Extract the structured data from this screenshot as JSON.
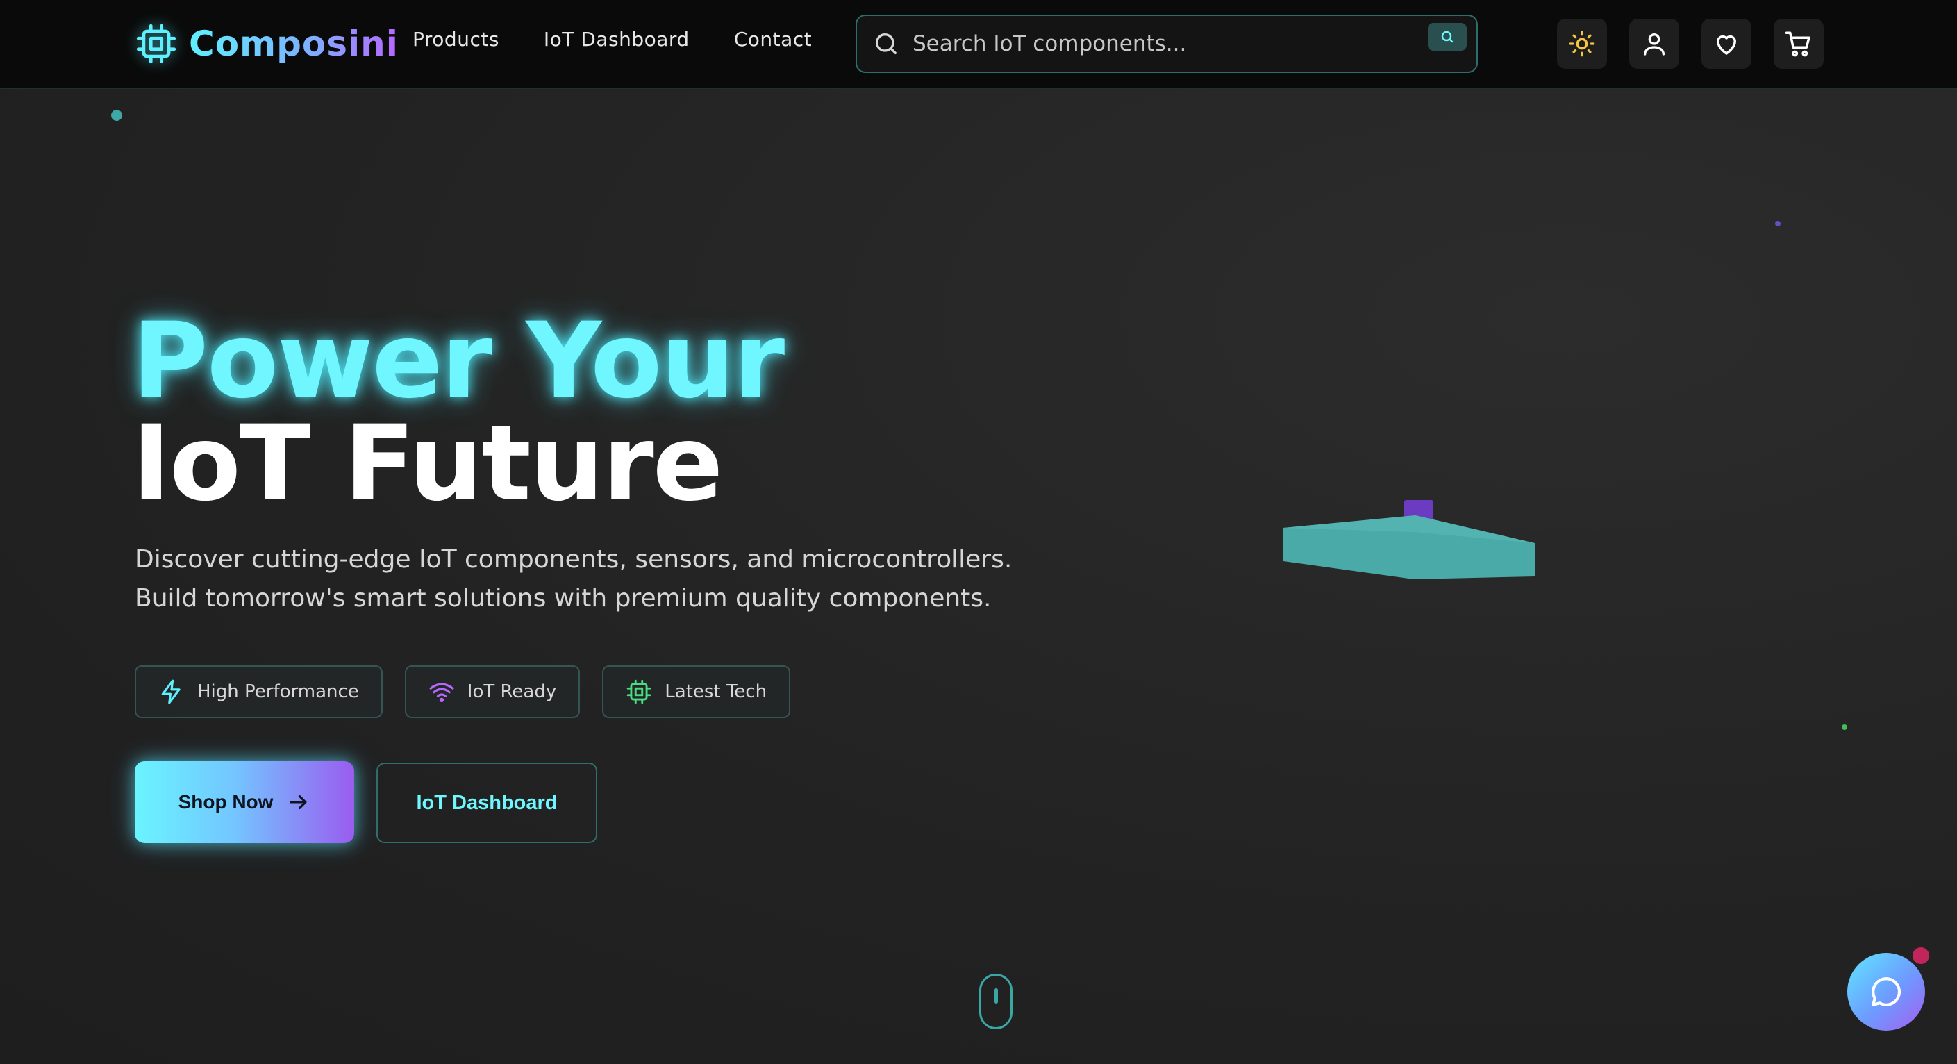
{
  "brand": {
    "name": "Composini",
    "logo_icon": "chip-icon"
  },
  "nav": {
    "items": [
      {
        "label": "Products"
      },
      {
        "label": "IoT Dashboard"
      },
      {
        "label": "Contact"
      }
    ]
  },
  "search": {
    "placeholder": "Search IoT components...",
    "value": ""
  },
  "header_actions": {
    "theme_icon": "sun-icon",
    "account_icon": "user-icon",
    "wishlist_icon": "heart-icon",
    "cart_icon": "cart-icon"
  },
  "hero": {
    "title_line1": "Power Your",
    "title_line2": "IoT Future",
    "description_line1": "Discover cutting-edge IoT components, sensors, and microcontrollers.",
    "description_line2": "Build tomorrow's smart solutions with premium quality components.",
    "features": [
      {
        "label": "High Performance",
        "icon": "lightning-icon",
        "color": "#5ff0ff"
      },
      {
        "label": "IoT Ready",
        "icon": "wifi-icon",
        "color": "#b667ff"
      },
      {
        "label": "Latest Tech",
        "icon": "chip-icon",
        "color": "#4ade80"
      }
    ],
    "primary_cta": "Shop Now",
    "secondary_cta": "IoT Dashboard"
  },
  "colors": {
    "accent_cyan": "#5ff0ff",
    "accent_purple": "#b667ff",
    "accent_green": "#4ade80",
    "background": "#262626",
    "header_bg": "#0a0a0a",
    "chat_badge": "#c2255c"
  },
  "chat": {
    "icon": "chat-bubble-icon"
  }
}
